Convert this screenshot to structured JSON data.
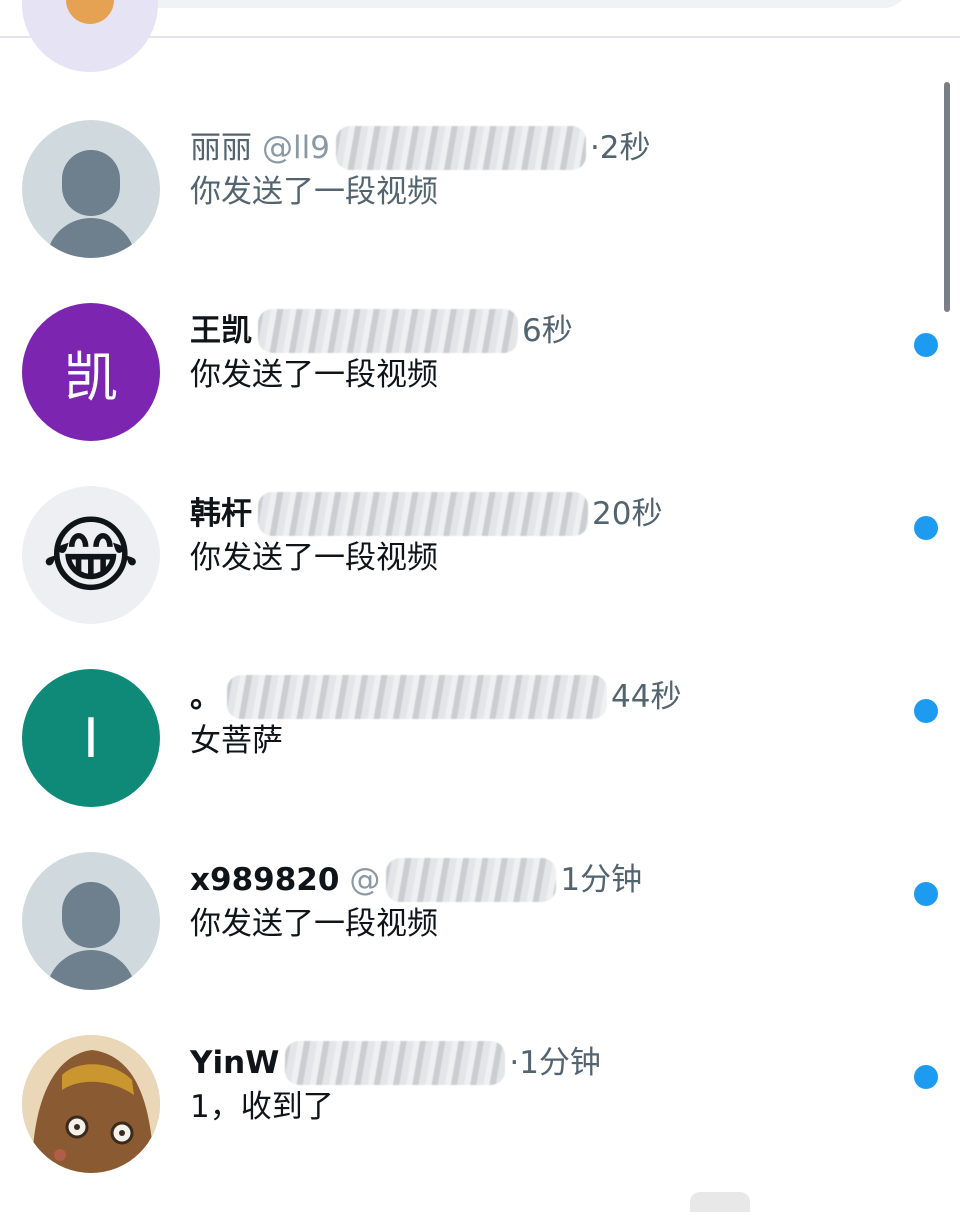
{
  "colors": {
    "accent_blue": "#1d9bf0",
    "avatar_kai": "#7b25b0",
    "avatar_i": "#0f8a79",
    "text_primary": "#0f1419",
    "text_secondary": "#536471"
  },
  "conversations": [
    {
      "name": "丽丽",
      "handle": "@ll9",
      "time": "·2秒",
      "preview": "你发送了一段视频",
      "avatar_icon": "default-profile-icon",
      "unread": false
    },
    {
      "name": "王凯",
      "handle": "",
      "time": "6秒",
      "preview": "你发送了一段视频",
      "avatar_text": "凯",
      "unread": true
    },
    {
      "name": "韩杆",
      "handle": "",
      "time": "20秒",
      "preview": "你发送了一段视频",
      "avatar_emoji": "😂",
      "unread": true
    },
    {
      "name": "。",
      "handle": "",
      "time": "44秒",
      "preview": "女菩萨",
      "avatar_text": "I",
      "unread": true
    },
    {
      "name": "x989820",
      "handle": "@",
      "time": "1分钟",
      "preview": "你发送了一段视频",
      "avatar_icon": "default-profile-icon",
      "unread": true
    },
    {
      "name": "YinW",
      "handle": "",
      "time": "·1分钟",
      "preview": "1，收到了",
      "avatar_icon": "cartoon-face-icon",
      "unread": true
    }
  ]
}
